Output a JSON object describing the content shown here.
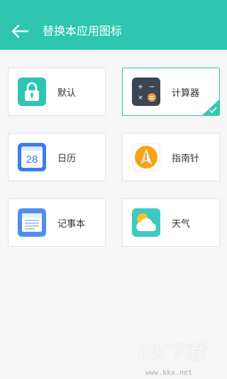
{
  "header": {
    "title": "替换本应用图标",
    "accent_color": "#2ec6b0",
    "back_icon": "arrow-left-icon"
  },
  "options": [
    {
      "label": "默认",
      "icon": "lock-icon",
      "icon_color": "#2ec6b0",
      "selected": false
    },
    {
      "label": "计算器",
      "icon": "calculator-icon",
      "icon_color": "#3c4556",
      "selected": true
    },
    {
      "label": "日历",
      "icon": "calendar-icon",
      "icon_color": "#3d7de6",
      "calendar_day": "28",
      "selected": false
    },
    {
      "label": "指南针",
      "icon": "compass-icon",
      "icon_color": "#f6a21d",
      "selected": false
    },
    {
      "label": "记事本",
      "icon": "notepad-icon",
      "icon_color": "#4e8fe8",
      "selected": false
    },
    {
      "label": "天气",
      "icon": "weather-icon",
      "icon_color": "#3fc9c1",
      "selected": false
    }
  ],
  "watermark": {
    "brand": "KK下载",
    "url": "www.kkx.net"
  }
}
